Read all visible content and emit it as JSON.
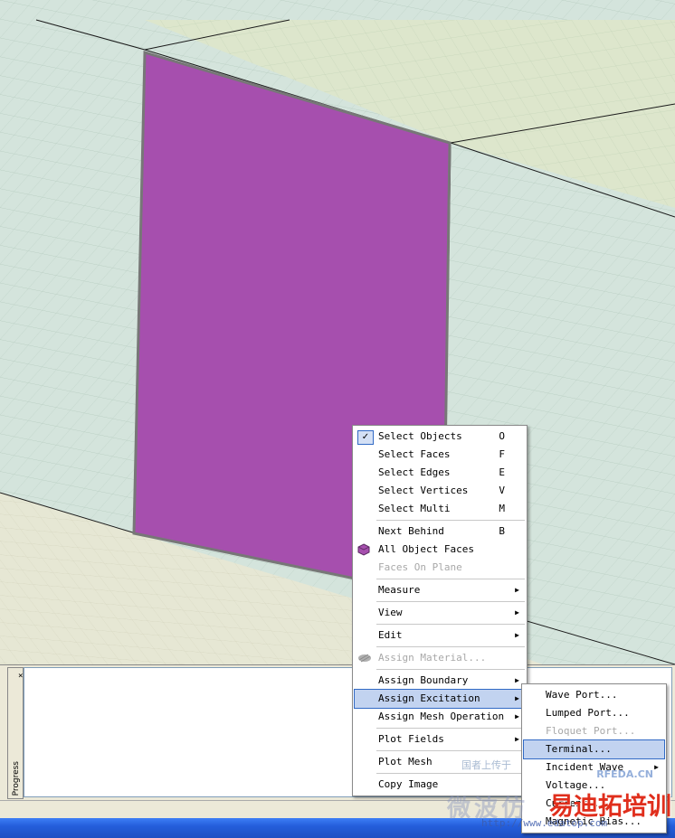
{
  "colors": {
    "face": "#a64fae",
    "menu_highlight": "#c2d3f0",
    "disabled_text": "#a8a8a8",
    "watermark_brand": "#e02e1c"
  },
  "context_menu": {
    "items": [
      {
        "label": "Select Objects",
        "shortcut": "O",
        "checked": true
      },
      {
        "label": "Select Faces",
        "shortcut": "F"
      },
      {
        "label": "Select Edges",
        "shortcut": "E"
      },
      {
        "label": "Select Vertices",
        "shortcut": "V"
      },
      {
        "label": "Select Multi",
        "shortcut": "M"
      },
      {
        "label": "Next Behind",
        "shortcut": "B"
      },
      {
        "label": "All Object Faces",
        "icon": "cube-face-icon"
      },
      {
        "label": "Faces On Plane",
        "disabled": true
      },
      {
        "label": "Measure",
        "submenu": true
      },
      {
        "label": "View",
        "submenu": true
      },
      {
        "label": "Edit",
        "submenu": true
      },
      {
        "label": "Assign Material...",
        "disabled": true,
        "icon": "material-icon"
      },
      {
        "label": "Assign Boundary",
        "submenu": true
      },
      {
        "label": "Assign Excitation",
        "submenu": true,
        "highlighted": true
      },
      {
        "label": "Assign Mesh Operation",
        "submenu": true
      },
      {
        "label": "Plot Fields",
        "submenu": true
      },
      {
        "label": "Plot Mesh"
      },
      {
        "label": "Copy Image"
      }
    ]
  },
  "excitation_submenu": {
    "items": [
      {
        "label": "Wave Port..."
      },
      {
        "label": "Lumped Port..."
      },
      {
        "label": "Floquet Port...",
        "disabled": true
      },
      {
        "label": "Terminal...",
        "highlighted": true
      },
      {
        "label": "Incident Wave",
        "submenu": true
      },
      {
        "label": "Voltage..."
      },
      {
        "label": "Current..."
      },
      {
        "label": "Magnetic Bias..."
      }
    ]
  },
  "progress_panel": {
    "label": "Progress",
    "close_glyph": "×"
  },
  "watermark": {
    "line1": "国者上传于",
    "rfeda": "RFEDA.CN",
    "cn_big": "微波仿",
    "brand": "易迪拓培训",
    "url": "http://www.edatop.com"
  }
}
